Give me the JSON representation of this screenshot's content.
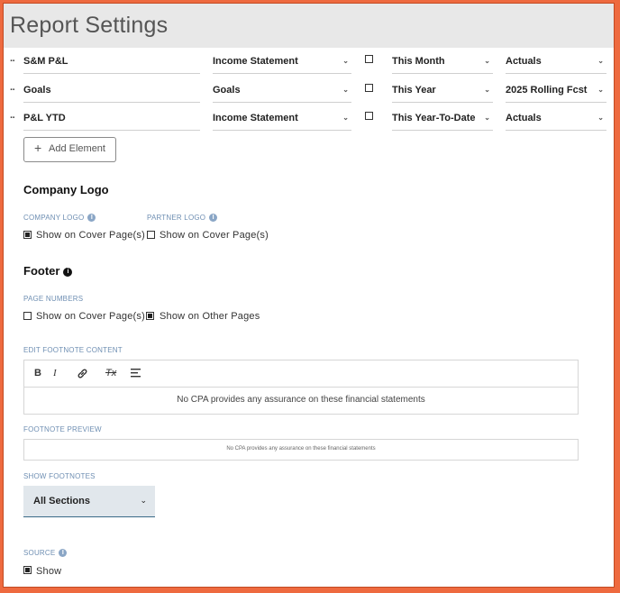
{
  "title": "Report Settings",
  "elements": [
    {
      "name": "S&M P&L",
      "statement": "Income Statement",
      "checked": false,
      "period": "This Month",
      "scenario": "Actuals"
    },
    {
      "name": "Goals",
      "statement": "Goals",
      "checked": false,
      "period": "This Year",
      "scenario": "2025 Rolling Fcst"
    },
    {
      "name": "P&L YTD",
      "statement": "Income Statement",
      "checked": false,
      "period": "This Year-To-Date",
      "scenario": "Actuals"
    }
  ],
  "add_element_label": "Add Element",
  "company_logo": {
    "heading": "Company Logo",
    "company_logo_caption": "COMPANY LOGO",
    "partner_logo_caption": "PARTNER LOGO",
    "company_show_label": "Show on Cover Page(s)",
    "company_show_checked": true,
    "partner_show_label": "Show on Cover Page(s)",
    "partner_show_checked": false
  },
  "footer": {
    "heading": "Footer",
    "page_numbers_caption": "PAGE NUMBERS",
    "cover_label": "Show on Cover Page(s)",
    "cover_checked": false,
    "other_label": "Show on Other Pages",
    "other_checked": true,
    "edit_caption": "EDIT FOOTNOTE CONTENT",
    "toolbar": {
      "bold": "B",
      "italic": "I",
      "link": "link-icon",
      "clear": "Tx",
      "align": "align-icon"
    },
    "footnote_text": "No CPA provides any assurance on these financial statements",
    "preview_caption": "FOOTNOTE PREVIEW",
    "preview_text": "No CPA provides any assurance on these financial statements",
    "show_footnotes_caption": "SHOW FOOTNOTES",
    "show_footnotes_value": "All Sections"
  },
  "source": {
    "caption": "SOURCE",
    "show_label": "Show",
    "show_checked": true
  },
  "colors": {
    "accent_border": "#ee6a3f",
    "caption": "#6f8fb3",
    "select_bg": "#e1e7ec"
  }
}
